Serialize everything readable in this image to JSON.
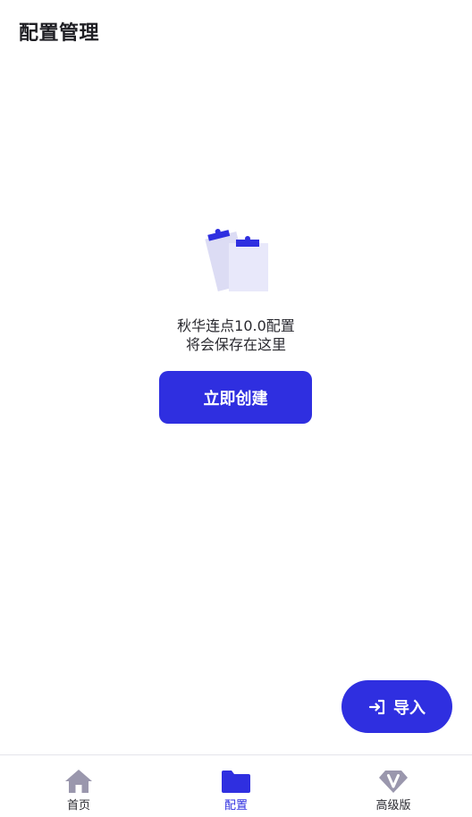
{
  "header": {
    "title": "配置管理"
  },
  "empty_state": {
    "line1": "秋华连点10.0配置",
    "line2": "将会保存在这里",
    "create_label": "立即创建",
    "illustration_icon": "clipboard-stack-icon"
  },
  "fab": {
    "import_label": "导入",
    "icon": "login-arrow-icon"
  },
  "bottom_nav": {
    "items": [
      {
        "label": "首页",
        "icon": "home-icon",
        "active": false
      },
      {
        "label": "配置",
        "icon": "folder-icon",
        "active": true
      },
      {
        "label": "高级版",
        "icon": "diamond-v-icon",
        "active": false
      }
    ]
  },
  "colors": {
    "accent": "#2f2fe0",
    "inactive_icon": "#9a97ad",
    "illustration_light": "#e6e6f8",
    "illustration_mid": "#d2d2ee"
  }
}
